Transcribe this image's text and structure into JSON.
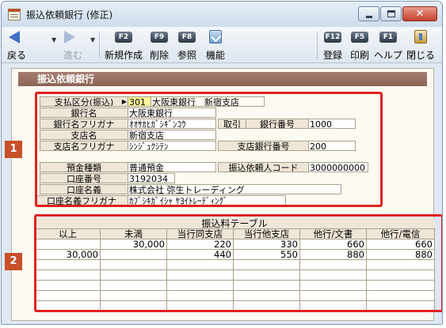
{
  "window": {
    "title": "振込依頼銀行 (修正)"
  },
  "toolbar": {
    "back": "戻る",
    "forward": "進む",
    "f2_key": "F2",
    "new": "新規作成",
    "f9_key": "F9",
    "delete": "削除",
    "f8_key": "F8",
    "reference": "参照",
    "function": "機能",
    "f12_key": "F12",
    "register": "登録",
    "f5_key": "F5",
    "print": "印刷",
    "f1_key": "F1",
    "help": "ヘルプ",
    "close": "閉じる"
  },
  "section": {
    "title": "振込依頼銀行"
  },
  "bank": {
    "payment_type_label": "支払区分(振込)",
    "payment_type_code": "301",
    "payment_type_value": "大阪東銀行　新宿支店",
    "bank_name_label": "銀行名",
    "bank_name": "大阪東銀行",
    "bank_kana_label": "銀行名フリガナ",
    "bank_kana": "ｵｵｻｶﾋｶﾞｼｷﾞﾝｺｳ",
    "trade_label": "取引",
    "bank_no_label": "銀行番号",
    "bank_no": "1000",
    "branch_name_label": "支店名",
    "branch_name": "新宿支店",
    "branch_kana_label": "支店名フリガナ",
    "branch_kana": "ｼﾝｼﾞｭｸｼﾃﾝ",
    "branch_no_label": "支店銀行番号",
    "branch_no": "200"
  },
  "account": {
    "type_label": "預金種類",
    "type": "普通預金",
    "requester_code_label": "振込依頼人コード",
    "requester_code": "3000000000",
    "number_label": "口座番号",
    "number": "3192034",
    "holder_label": "口座名義",
    "holder": "株式会社 弥生トレーディング",
    "holder_kana_label": "口座名義フリガナ",
    "holder_kana": "ｶﾌﾞｼｷｶﾞｲｼｬ ﾔﾖｲﾄﾚｰﾃﾞｨﾝｸﾞ"
  },
  "fee_table": {
    "title": "振込料テーブル",
    "columns": [
      "以上",
      "未満",
      "当行同支店",
      "当行他支店",
      "他行/文書",
      "他行/電信"
    ],
    "rows": [
      [
        "",
        "30,000",
        "220",
        "330",
        "660",
        "660"
      ],
      [
        "30,000",
        "",
        "440",
        "550",
        "880",
        "880"
      ],
      [
        "",
        "",
        "",
        "",
        "",
        ""
      ],
      [
        "",
        "",
        "",
        "",
        "",
        ""
      ],
      [
        "",
        "",
        "",
        "",
        "",
        ""
      ],
      [
        "",
        "",
        "",
        "",
        "",
        ""
      ],
      [
        "",
        "",
        "",
        "",
        "",
        ""
      ]
    ]
  },
  "callouts": {
    "one": "1",
    "two": "2"
  },
  "colors": {
    "section_bar": "#8a6457",
    "callout": "#c8502a",
    "highlight": "#e0201e"
  }
}
